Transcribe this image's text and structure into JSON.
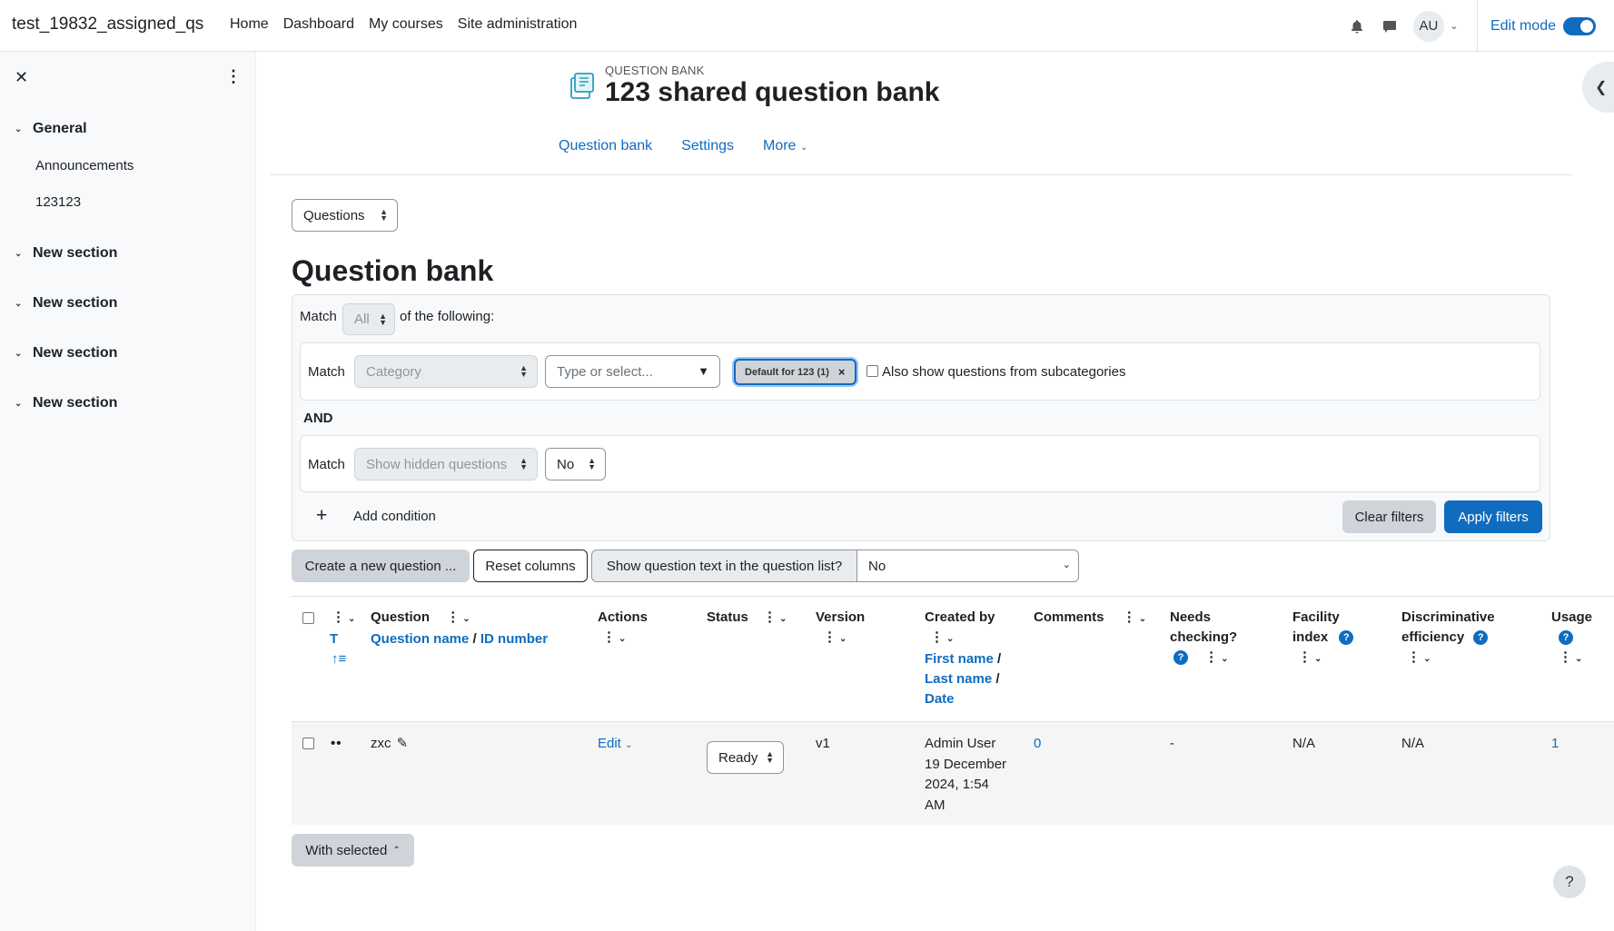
{
  "site": {
    "name": "test_19832_assigned_qs"
  },
  "primary_nav": {
    "home": "Home",
    "dashboard": "Dashboard",
    "my_courses": "My courses",
    "site_admin": "Site administration"
  },
  "user": {
    "initials": "AU"
  },
  "edit_mode": {
    "label": "Edit mode",
    "enabled": true
  },
  "drawer": {
    "sections": [
      {
        "title": "General",
        "items": [
          "Announcements",
          "123123"
        ]
      },
      {
        "title": "New section"
      },
      {
        "title": "New section"
      },
      {
        "title": "New section"
      },
      {
        "title": "New section"
      }
    ]
  },
  "header": {
    "pre": "QUESTION BANK",
    "title": "123 shared question bank"
  },
  "secondary_nav": {
    "question_bank": "Question bank",
    "settings": "Settings",
    "more": "More"
  },
  "questions_select": "Questions",
  "page_heading": "Question bank",
  "filters": {
    "match_label": "Match",
    "match_all": "All",
    "of_following": "of the following:",
    "category_field": "Category",
    "type_placeholder": "Type or select...",
    "selected_category": "Default for 123 (1)",
    "subcategories_label": "Also show questions from subcategories",
    "and_label": "AND",
    "hidden_field": "Show hidden questions",
    "hidden_value": "No",
    "add_condition": "Add condition",
    "clear": "Clear filters",
    "apply": "Apply filters"
  },
  "toolbar": {
    "create": "Create a new question ...",
    "reset": "Reset columns",
    "show_text_label": "Show question text in the question list?",
    "show_text_value": "No"
  },
  "table": {
    "headers": {
      "type_short": "T",
      "question": "Question",
      "question_name": "Question name",
      "id_number": "ID number",
      "actions": "Actions",
      "status": "Status",
      "version": "Version",
      "created_by": "Created by",
      "first_name": "First name",
      "last_name": "Last name",
      "date": "Date",
      "comments": "Comments",
      "needs_checking_1": "Needs",
      "needs_checking_2": "checking?",
      "facility_1": "Facility",
      "facility_2": "index",
      "discrim_1": "Discriminative",
      "discrim_2": "efficiency",
      "usage": "Usage"
    },
    "rows": [
      {
        "name": "zxc",
        "edit": "Edit",
        "status": "Ready",
        "version": "v1",
        "created_by": "Admin User",
        "created_date_1": "19 December",
        "created_date_2": "2024, 1:54",
        "created_date_3": "AM",
        "comments": "0",
        "needs_checking": "-",
        "facility": "N/A",
        "discrim": "N/A",
        "usage": "1"
      }
    ]
  },
  "with_selected": "With selected",
  "help_button": "?"
}
